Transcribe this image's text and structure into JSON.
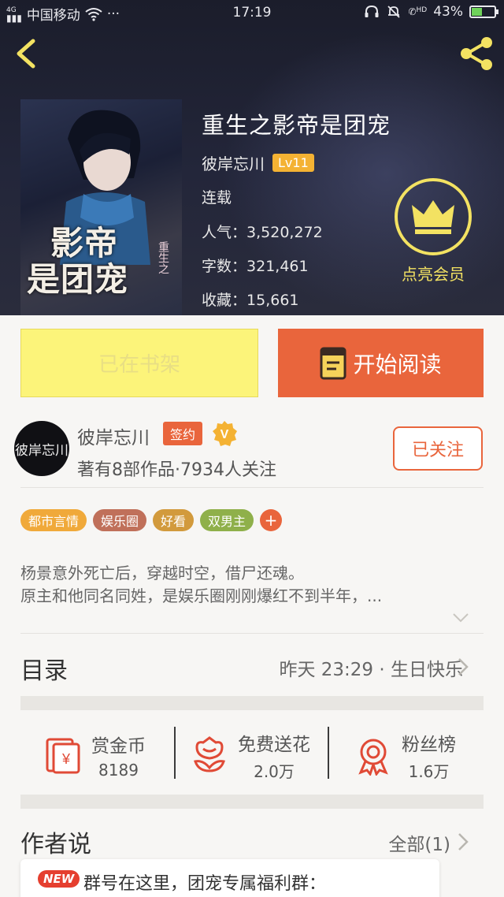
{
  "status_bar": {
    "carrier": "中国移动",
    "time": "17:19",
    "battery": "43%",
    "network": "4G",
    "dots": "···",
    "hd": "HD"
  },
  "book": {
    "title": "重生之影帝是团宠",
    "author": "彼岸忘川",
    "level": "Lv11",
    "status": "连载",
    "popularity_label": "人气：",
    "popularity": "3,520,272",
    "words_label": "字数：",
    "words": "321,461",
    "favorites_label": "收藏：",
    "favorites": "15,661",
    "cover_title_line1": "影帝",
    "cover_title_line2": "是团宠",
    "cover_subtitle": "重生之"
  },
  "vip": {
    "label": "点亮会员"
  },
  "actions": {
    "shelf_label": "已在书架",
    "read_label": "开始阅读"
  },
  "author_card": {
    "avatar_text": "彼岸忘川",
    "name": "彼岸忘川",
    "sign_badge": "签约",
    "verified_badge": "V",
    "stats": "著有8部作品·7934人关注",
    "follow_label": "已关注"
  },
  "tags": [
    {
      "label": "都市言情",
      "color": "#f0a93a"
    },
    {
      "label": "娱乐圈",
      "color": "#c0705a"
    },
    {
      "label": "好看",
      "color": "#d29a3c"
    },
    {
      "label": "双男主",
      "color": "#8fb04a"
    }
  ],
  "tag_more": "+",
  "description": {
    "line1": "杨景意外死亡后，穿越时空，借尸还魂。",
    "line2": "原主和他同名同姓，是娱乐圈刚刚爆红不到半年，..."
  },
  "catalog": {
    "title": "目录",
    "latest": "昨天 23:29 · 生日快乐"
  },
  "rewards": [
    {
      "label": "赏金币",
      "value": "8189",
      "icon": "red-envelope-icon"
    },
    {
      "label": "免费送花",
      "value": "2.0万",
      "icon": "flower-icon"
    },
    {
      "label": "粉丝榜",
      "value": "1.6万",
      "icon": "medal-icon"
    }
  ],
  "author_says": {
    "title": "作者说",
    "all_label": "全部(1)",
    "new_badge": "NEW",
    "post_text": "群号在这里，团宠专属福利群："
  },
  "colors": {
    "accent": "#e9653c",
    "shelf_yellow": "#fcf47a",
    "vip_gold": "#f3e262",
    "level_badge": "#f4b233"
  }
}
